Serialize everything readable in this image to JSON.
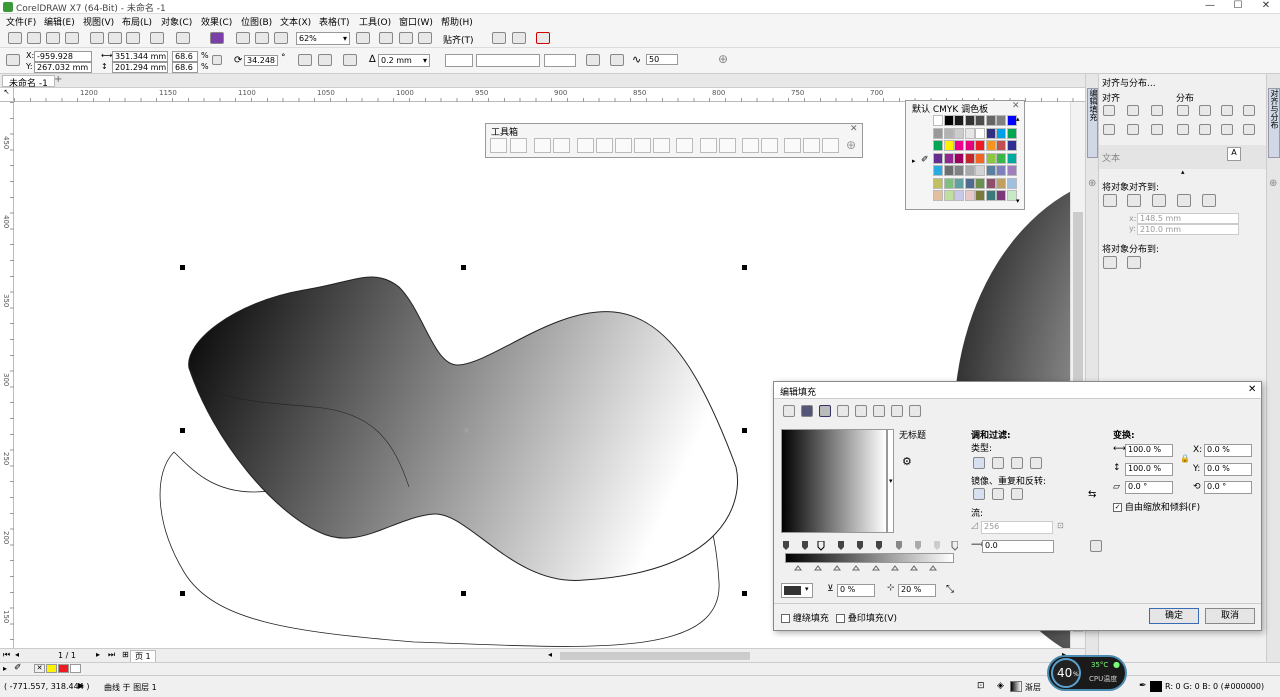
{
  "app": {
    "title": "CorelDRAW X7 (64-Bit) - 未命名 -1"
  },
  "window": {
    "min": "—",
    "max": "☐",
    "close": "✕"
  },
  "menu": [
    "文件(F)",
    "编辑(E)",
    "视图(V)",
    "布局(L)",
    "对象(C)",
    "效果(C)",
    "位图(B)",
    "文本(X)",
    "表格(T)",
    "工具(O)",
    "窗口(W)",
    "帮助(H)"
  ],
  "toolbar": {
    "zoom": "62%",
    "snap": "贴齐(T)"
  },
  "props": {
    "x": "-959.928 mm",
    "y": "267.032 mm",
    "w": "351.344 mm",
    "h": "201.294 mm",
    "sx": "68.6",
    "sy": "68.6",
    "pct": "%",
    "angle": "34.248",
    "deg": "°",
    "outline": "0.2 mm",
    "smooth": "50"
  },
  "tabs": {
    "doc": "未命名 -1",
    "add": "+"
  },
  "ruler": {
    "h": [
      "1200",
      "1150",
      "1100",
      "1050",
      "1000",
      "950",
      "900",
      "850",
      "800",
      "750",
      "700"
    ],
    "v": [
      "450",
      "400",
      "350",
      "300",
      "250",
      "200",
      "150"
    ]
  },
  "toolbox": {
    "title": "工具箱",
    "close": "✕"
  },
  "palette": {
    "title": "默认 CMYK 调色板",
    "close": "✕"
  },
  "dialog": {
    "title": "编辑填充",
    "close": "✕",
    "fill_name": "无标题",
    "blend_label": "调和过滤:",
    "type_label": "类型:",
    "mirror_label": "镜像、重复和反转:",
    "flow_label": "流:",
    "flow_value": "256",
    "offset_value": "0.0",
    "opacity_value": "0 %",
    "midpoint_value": "20 %",
    "transform_label": "变换:",
    "w_value": "100.0 %",
    "h_value": "100.0 %",
    "x_label": "X:",
    "x_value": "0.0 %",
    "y_label": "Y:",
    "y_value": "0.0 %",
    "skew_value": "0.0 °",
    "rot_value": "0.0 °",
    "free_scale": "自由缩放和倾斜(F)",
    "wrap_fill": "缠绕填充",
    "overprint": "叠印填充(V)",
    "ok": "确定",
    "cancel": "取消"
  },
  "align_panel": {
    "title": "对齐与分布...",
    "align_label": "对齐",
    "distribute_label": "分布",
    "text_label": "文本",
    "align_to_label": "将对象对齐到:",
    "x_label": "x:",
    "x_value": "148.5 mm",
    "y_label": "y:",
    "y_value": "210.0 mm",
    "dist_to_label": "将对象分布到:"
  },
  "docker_tabs": {
    "fill_tab": "编辑填充",
    "align_tab": "对齐与分布"
  },
  "page_nav": {
    "pages": "1 / 1",
    "page_tab": "页 1"
  },
  "status": {
    "coords": "( -771.557, 318.444 )",
    "info": "曲线 于 图层 1",
    "fill_label": "渐层",
    "color_info": "R: 0 G: 0 B: 0 (#000000)"
  },
  "cpu": {
    "percent": "40",
    "unit": "%",
    "temp": "35°C",
    "label": "CPU温度"
  },
  "palette_colors": [
    "#ffffff",
    "#000000",
    "#1a1a1a",
    "#333333",
    "#4d4d4d",
    "#666666",
    "#808080",
    "#0000ff",
    "#999999",
    "#b3b3b3",
    "#cccccc",
    "#e6e6e6",
    "#ffffff",
    "#303080",
    "#00a0e9",
    "#00a651",
    "#00a651",
    "#fff200",
    "#ec008c",
    "#e4007f",
    "#ed1c24",
    "#f7941d",
    "#c05050",
    "#2e3192",
    "#662d91",
    "#92278f",
    "#9e005d",
    "#c1272d",
    "#f26522",
    "#8dc63f",
    "#39b54a",
    "#00a99d",
    "#29abe2",
    "#6d6e71",
    "#808285",
    "#a7a9ac",
    "#d1d3d4",
    "#5a7fa0",
    "#7f7fbf",
    "#a07fbf",
    "#c0c060",
    "#7fbf7f",
    "#60a0a0",
    "#4f6b8f",
    "#6b8f4f",
    "#8f4f6b",
    "#bfa060",
    "#a0c0e0",
    "#e0c0a0",
    "#c0e0a0",
    "#c8c8e8",
    "#e8c8c8",
    "#7a7a3a",
    "#3a7a7a",
    "#7a3a7a",
    "#c8e8c8"
  ],
  "color_swatches": [
    "#ffffff",
    "#fff200",
    "#ed1c24",
    "#ffffff"
  ]
}
